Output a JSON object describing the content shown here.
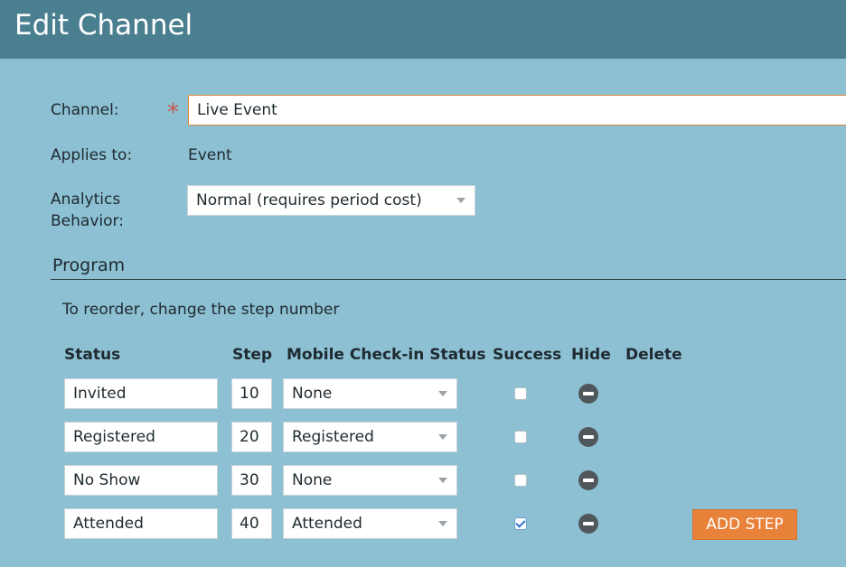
{
  "header": {
    "title": "Edit Channel"
  },
  "form": {
    "channel_label": "Channel:",
    "channel_value": "Live Event",
    "applies_label": "Applies to:",
    "applies_value": "Event",
    "analytics_label_line1": "Analytics",
    "analytics_label_line2": "Behavior:",
    "analytics_value": "Normal (requires period cost)"
  },
  "program": {
    "section_title": "Program",
    "hint": "To reorder, change the step number",
    "headers": {
      "status": "Status",
      "step": "Step",
      "mobile": "Mobile Check-in Status",
      "success": "Success",
      "hide": "Hide",
      "delete": "Delete"
    },
    "rows": [
      {
        "status": "Invited",
        "step": "10",
        "mobile": "None",
        "success": false
      },
      {
        "status": "Registered",
        "step": "20",
        "mobile": "Registered",
        "success": false
      },
      {
        "status": "No Show",
        "step": "30",
        "mobile": "None",
        "success": false
      },
      {
        "status": "Attended",
        "step": "40",
        "mobile": "Attended",
        "success": true
      }
    ],
    "add_step_label": "ADD STEP"
  },
  "icons": {
    "required": "asterisk-icon",
    "hide": "minus-circle-icon",
    "dropdown": "caret-down-icon"
  },
  "colors": {
    "header_bg": "#4a7f90",
    "page_bg": "#8cc0d2",
    "accent": "#e8823a",
    "required": "#c8584a"
  }
}
